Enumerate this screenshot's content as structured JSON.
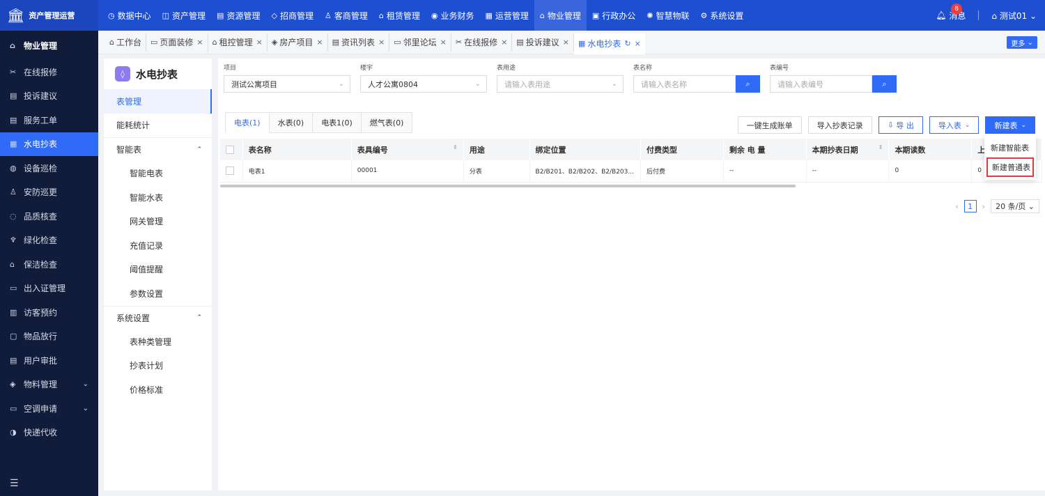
{
  "brand": {
    "title": "资产管理运营"
  },
  "topnav": [
    {
      "label": "数据中心",
      "icon": "◷"
    },
    {
      "label": "资产管理",
      "icon": "◫"
    },
    {
      "label": "资源管理",
      "icon": "▤"
    },
    {
      "label": "招商管理",
      "icon": "◇"
    },
    {
      "label": "客商管理",
      "icon": "♙"
    },
    {
      "label": "租赁管理",
      "icon": "⌂"
    },
    {
      "label": "业务财务",
      "icon": "◉"
    },
    {
      "label": "运营管理",
      "icon": "▦"
    },
    {
      "label": "物业管理",
      "icon": "⌂"
    },
    {
      "label": "行政办公",
      "icon": "▣"
    },
    {
      "label": "智慧物联",
      "icon": "✺"
    },
    {
      "label": "系统设置",
      "icon": "⚙"
    }
  ],
  "topright": {
    "message_label": "消息",
    "message_count": "8",
    "user_label": "测试01"
  },
  "sidebar": {
    "header": "物业管理",
    "items": [
      {
        "label": "在线报修",
        "icon": "✂"
      },
      {
        "label": "投诉建议",
        "icon": "▤"
      },
      {
        "label": "服务工单",
        "icon": "▤"
      },
      {
        "label": "水电抄表",
        "icon": "▦"
      },
      {
        "label": "设备巡检",
        "icon": "◍"
      },
      {
        "label": "安防巡更",
        "icon": "♙"
      },
      {
        "label": "品质核查",
        "icon": "◌"
      },
      {
        "label": "绿化检查",
        "icon": "♆"
      },
      {
        "label": "保洁检查",
        "icon": "⌂"
      },
      {
        "label": "出入证管理",
        "icon": "▭"
      },
      {
        "label": "访客预约",
        "icon": "▥"
      },
      {
        "label": "物品放行",
        "icon": "▢"
      },
      {
        "label": "用户审批",
        "icon": "▤"
      },
      {
        "label": "物料管理",
        "icon": "◈"
      },
      {
        "label": "空调申请",
        "icon": "▭"
      },
      {
        "label": "快递代收",
        "icon": "◑"
      }
    ]
  },
  "tabs": [
    {
      "label": "工作台",
      "icon": "⌂",
      "closable": false
    },
    {
      "label": "页面装修",
      "icon": "▭",
      "closable": true
    },
    {
      "label": "租控管理",
      "icon": "⌂",
      "closable": true
    },
    {
      "label": "房产项目",
      "icon": "◈",
      "closable": true
    },
    {
      "label": "资讯列表",
      "icon": "▤",
      "closable": true
    },
    {
      "label": "邻里论坛",
      "icon": "▭",
      "closable": true
    },
    {
      "label": "在线报修",
      "icon": "✂",
      "closable": true
    },
    {
      "label": "投诉建议",
      "icon": "▤",
      "closable": true
    },
    {
      "label": "水电抄表",
      "icon": "▦",
      "closable": true
    }
  ],
  "more_label": "更多",
  "subpanel": {
    "title": "水电抄表",
    "items": [
      {
        "label": "表管理",
        "type": "top"
      },
      {
        "label": "能耗统计",
        "type": "top"
      },
      {
        "label": "智能表",
        "type": "group"
      },
      {
        "label": "智能电表",
        "type": "child"
      },
      {
        "label": "智能水表",
        "type": "child"
      },
      {
        "label": "网关管理",
        "type": "child"
      },
      {
        "label": "充值记录",
        "type": "child"
      },
      {
        "label": "阈值提醒",
        "type": "child"
      },
      {
        "label": "参数设置",
        "type": "child"
      },
      {
        "label": "系统设置",
        "type": "group"
      },
      {
        "label": "表种类管理",
        "type": "child"
      },
      {
        "label": "抄表计划",
        "type": "child"
      },
      {
        "label": "价格标准",
        "type": "child"
      }
    ]
  },
  "filters": {
    "project": {
      "label": "项目",
      "value": "测试公寓项目"
    },
    "building": {
      "label": "楼宇",
      "value": "人才公寓0804"
    },
    "usage": {
      "label": "表用途",
      "placeholder": "请输入表用途"
    },
    "meter_name": {
      "label": "表名称",
      "placeholder": "请输入表名称"
    },
    "meter_no": {
      "label": "表编号",
      "placeholder": "请输入表编号"
    }
  },
  "type_tabs": [
    "电表(1)",
    "水表(0)",
    "电表1(0)",
    "燃气表(0)"
  ],
  "actions": {
    "gen_bill": "一键生成账单",
    "import_record": "导入抄表记录",
    "export": "导 出",
    "import_meter": "导入表",
    "new_meter": "新建表"
  },
  "table": {
    "headers": [
      "表名称",
      "表具编号",
      "用途",
      "绑定位置",
      "付费类型",
      "剩余 电 量",
      "本期抄表日期",
      "本期读数",
      "上"
    ],
    "rows": [
      [
        "电表1",
        "00001",
        "分表",
        "B2/B201、B2/B202、B2/B203...",
        "后付费",
        "--",
        "--",
        "0",
        "0"
      ]
    ]
  },
  "pager": {
    "page": "1",
    "size": "20 条/页"
  },
  "dropdown": {
    "items": [
      "新建智能表",
      "新建普通表"
    ]
  },
  "colors": {
    "primary": "#2f6bf6",
    "topbar": "#1f4fd1",
    "sidebar": "#101c3a",
    "highlight": "#e5393b"
  }
}
